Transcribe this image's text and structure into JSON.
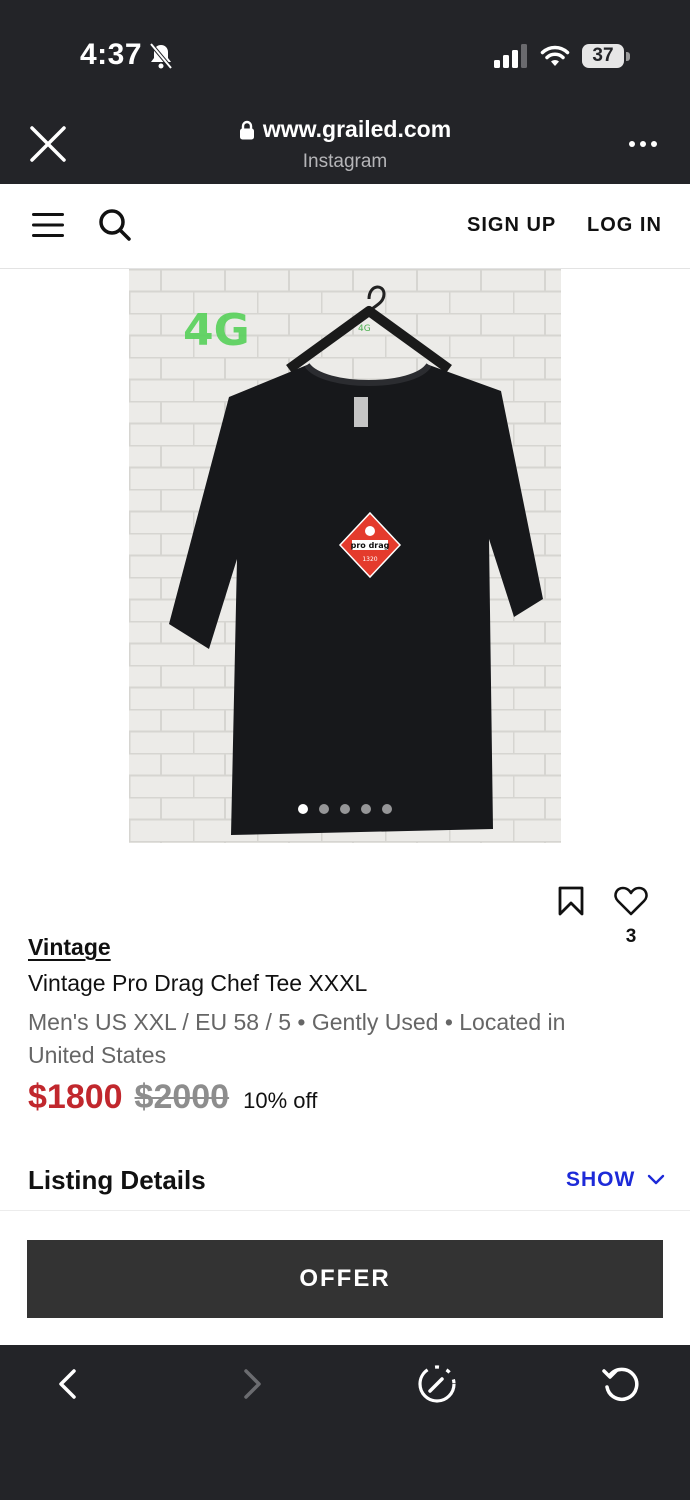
{
  "status_bar": {
    "time": "4:37",
    "battery": "37",
    "battery_level": 0.37
  },
  "browser": {
    "url": "www.grailed.com",
    "source": "Instagram"
  },
  "site_header": {
    "signup_label": "SIGN UP",
    "login_label": "LOG IN"
  },
  "gallery": {
    "image_count": 5,
    "active_index": 0,
    "graffiti_text": "4G",
    "hanger_text": "4G",
    "logo_text": "pro drag",
    "logo_number": "1320"
  },
  "actions": {
    "like_count": "3"
  },
  "listing": {
    "designer": "Vintage",
    "title": "Vintage Pro Drag Chef Tee XXXL",
    "meta": "Men's US XXL / EU 58 / 5 • Gently Used • Located in United States",
    "price": "$1800",
    "original_price": "$2000",
    "discount": "10% off",
    "details_heading": "Listing Details",
    "show_label": "SHOW"
  },
  "offer": {
    "button_label": "OFFER"
  },
  "colors": {
    "chrome_bg": "#232428",
    "price_red": "#c1272d",
    "link_blue": "#1d2ad8",
    "offer_bg": "#333333"
  }
}
